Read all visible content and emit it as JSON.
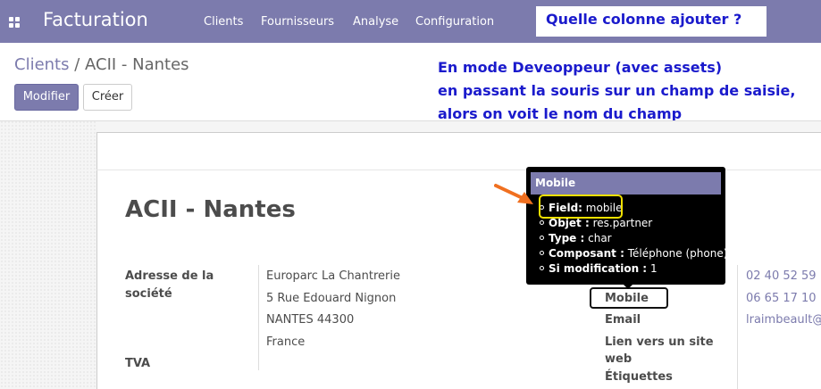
{
  "navbar": {
    "app_title": "Facturation",
    "items": [
      "Clients",
      "Fournisseurs",
      "Analyse",
      "Configuration"
    ]
  },
  "annotations": {
    "question": "Quelle colonne ajouter ?",
    "lines": [
      "En mode Deveoppeur (avec assets)",
      "en passant la souris sur un champ de saisie,",
      "alors on voit le nom du champ"
    ]
  },
  "breadcrumb": {
    "parent": "Clients",
    "separator": " / ",
    "current": "ACII - Nantes"
  },
  "buttons": {
    "edit": "Modifier",
    "create": "Créer"
  },
  "form": {
    "name": "ACII - Nantes",
    "address_label_1": "Adresse de la",
    "address_label_2": "société",
    "address_lines": [
      "Europarc La Chantrerie",
      "5 Rue Edouard Nignon",
      "NANTES  44300",
      "France"
    ],
    "vat_label": "TVA",
    "right_labels": {
      "mobile": "Mobile",
      "email": "Email",
      "website_1": "Lien vers un site",
      "website_2": "web",
      "tags": "Étiquettes"
    },
    "right_values": {
      "phone": "02 40 52 59",
      "mobile": "06 65 17 10",
      "email": "lraimbeault@"
    }
  },
  "tooltip": {
    "title": "Mobile",
    "rows": [
      {
        "key": "Field:",
        "value": "mobile"
      },
      {
        "key": "Objet :",
        "value": "res.partner"
      },
      {
        "key": "Type :",
        "value": "char"
      },
      {
        "key": "Composant :",
        "value": "Téléphone (phone)"
      },
      {
        "key": "Si modification :",
        "value": "1"
      }
    ]
  },
  "colors": {
    "brand": "#7c7bad",
    "annotation_text": "#1a1acc",
    "arrow": "#f07020",
    "highlight": "#f0e000"
  }
}
